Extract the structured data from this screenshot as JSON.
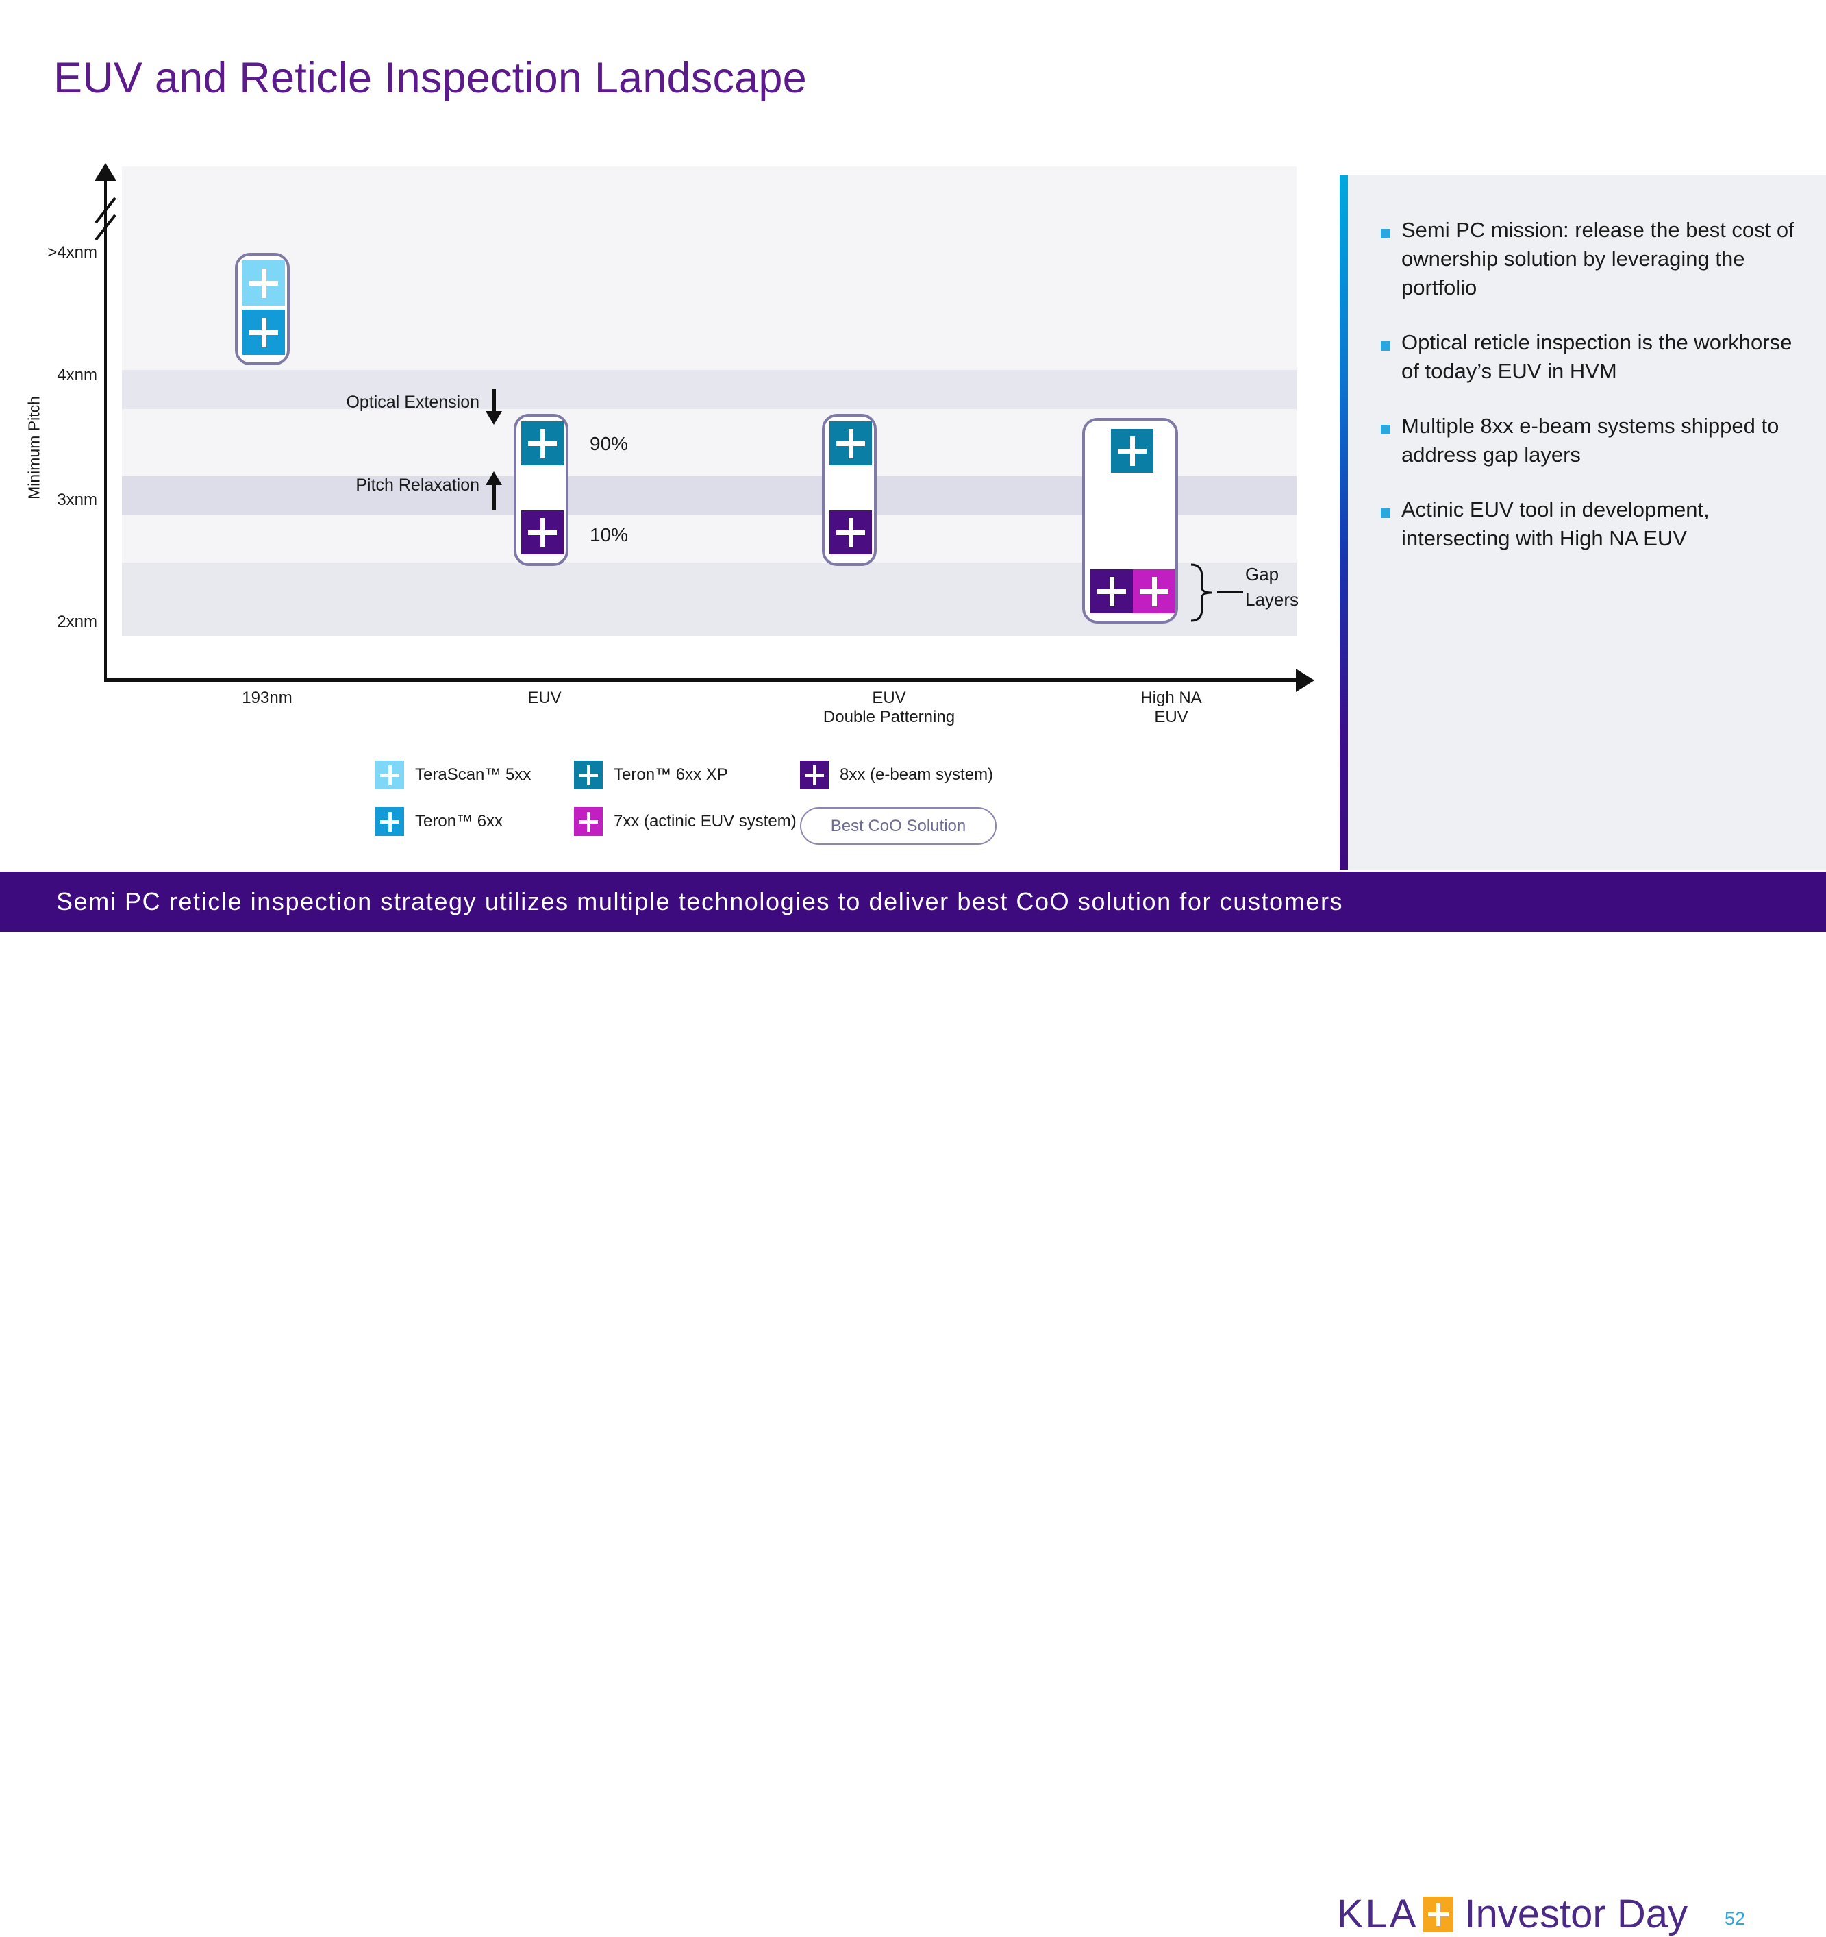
{
  "slide": {
    "title": "EUV and Reticle Inspection Landscape",
    "banner": "Semi PC reticle inspection strategy utilizes multiple technologies to deliver best CoO solution for customers",
    "page_number": "52"
  },
  "footer": {
    "logo_word": "KLA",
    "logo_plus_icon": "plus-icon",
    "brand": "Investor Day",
    "logo_plus_color": "#f7a71d",
    "brand_color": "#4b2a86"
  },
  "chart_data": {
    "type": "scatter",
    "title": "EUV and Reticle Inspection Landscape",
    "ylabel": "Minimum Pitch",
    "xlabel": "",
    "y_ticks": [
      ">4xnm",
      "4xnm",
      "3xnm",
      "2xnm"
    ],
    "x_categories": [
      "193nm",
      "EUV",
      "EUV\nDouble Patterning",
      "High NA\nEUV"
    ],
    "x_tick_labels": [
      {
        "line1": "193nm",
        "line2": ""
      },
      {
        "line1": "EUV",
        "line2": ""
      },
      {
        "line1": "EUV",
        "line2": "Double Patterning"
      },
      {
        "line1": "High NA",
        "line2": "EUV"
      }
    ],
    "grid": false,
    "legend_position": "bottom",
    "axis_break": true,
    "series": [
      {
        "name": "193nm",
        "column": 0,
        "tools": [
          {
            "tool": "TeraScan™ 5xx",
            "color": "#7fd7f7",
            "pitch_band": ">4xnm",
            "share": ""
          },
          {
            "tool": "Teron™ 6xx",
            "color": "#129bd7",
            "pitch_band": ">4xnm",
            "share": ""
          }
        ]
      },
      {
        "name": "EUV",
        "column": 1,
        "tools": [
          {
            "tool": "Teron™ 6xx XP",
            "color": "#0a7ea4",
            "pitch_band": "4xnm-3xnm",
            "share": "90%"
          },
          {
            "tool": "8xx (e-beam system)",
            "color": "#4a0d82",
            "pitch_band": "3xnm",
            "share": "10%"
          }
        ]
      },
      {
        "name": "EUV Double Patterning",
        "column": 2,
        "tools": [
          {
            "tool": "Teron™ 6xx XP",
            "color": "#0a7ea4",
            "pitch_band": "4xnm-3xnm",
            "share": ""
          },
          {
            "tool": "8xx (e-beam system)",
            "color": "#4a0d82",
            "pitch_band": "3xnm",
            "share": ""
          }
        ]
      },
      {
        "name": "High NA EUV",
        "column": 3,
        "tools": [
          {
            "tool": "Teron™ 6xx XP",
            "color": "#0a7ea4",
            "pitch_band": "4xnm-3xnm",
            "share": ""
          },
          {
            "tool": "8xx (e-beam system)",
            "color": "#4a0d82",
            "pitch_band": "2xnm",
            "share": ""
          },
          {
            "tool": "7xx (actinic EUV system)",
            "color": "#c11fc1",
            "pitch_band": "2xnm",
            "share": ""
          }
        ]
      }
    ],
    "annotations": [
      {
        "label": "Optical Extension",
        "arrow": "down"
      },
      {
        "label": "Pitch Relaxation",
        "arrow": "up"
      },
      {
        "label": "Gap\nLayers",
        "arrow": "brace"
      }
    ],
    "data_labels": [
      "90%",
      "10%"
    ]
  },
  "annotations": {
    "optical_extension": "Optical Extension",
    "pitch_relaxation": "Pitch Relaxation",
    "gap_layers_line1": "Gap",
    "gap_layers_line2": "Layers",
    "pct_top": "90%",
    "pct_bottom": "10%"
  },
  "axis": {
    "y_title": "Minimum Pitch",
    "y_tick_0": ">4xnm",
    "y_tick_1": "4xnm",
    "y_tick_2": "3xnm",
    "y_tick_3": "2xnm",
    "x_tick_0_l1": "193nm",
    "x_tick_1_l1": "EUV",
    "x_tick_2_l1": "EUV",
    "x_tick_2_l2": "Double Patterning",
    "x_tick_3_l1": "High NA",
    "x_tick_3_l2": "EUV"
  },
  "legend": {
    "items": [
      {
        "label": "TeraScan™ 5xx",
        "color": "#7fd7f7"
      },
      {
        "label": "Teron™ 6xx",
        "color": "#129bd7"
      },
      {
        "label": "Teron™ 6xx XP",
        "color": "#0a7ea4"
      },
      {
        "label": "7xx (actinic EUV system)",
        "color": "#c11fc1"
      },
      {
        "label": "8xx (e-beam system)",
        "color": "#4a0d82"
      }
    ],
    "best_coo": "Best CoO Solution"
  },
  "sidebar": {
    "bullets": [
      "Semi PC mission: release the best cost of ownership solution by leveraging the portfolio",
      "Optical reticle inspection is the workhorse of today’s EUV in HVM",
      "Multiple 8xx e-beam systems shipped to address gap layers",
      "Actinic EUV tool in development, intersecting with High NA EUV"
    ],
    "bullet_marker_color": "#29a8e0"
  },
  "colors": {
    "title_purple": "#5b1b8a",
    "banner_purple": "#3d0b7d",
    "panel_bg": "#eff0f4",
    "plot_bg": "#f5f5f8",
    "group_border": "#7e7aa5",
    "accent_cyan": "#00a9e0"
  }
}
